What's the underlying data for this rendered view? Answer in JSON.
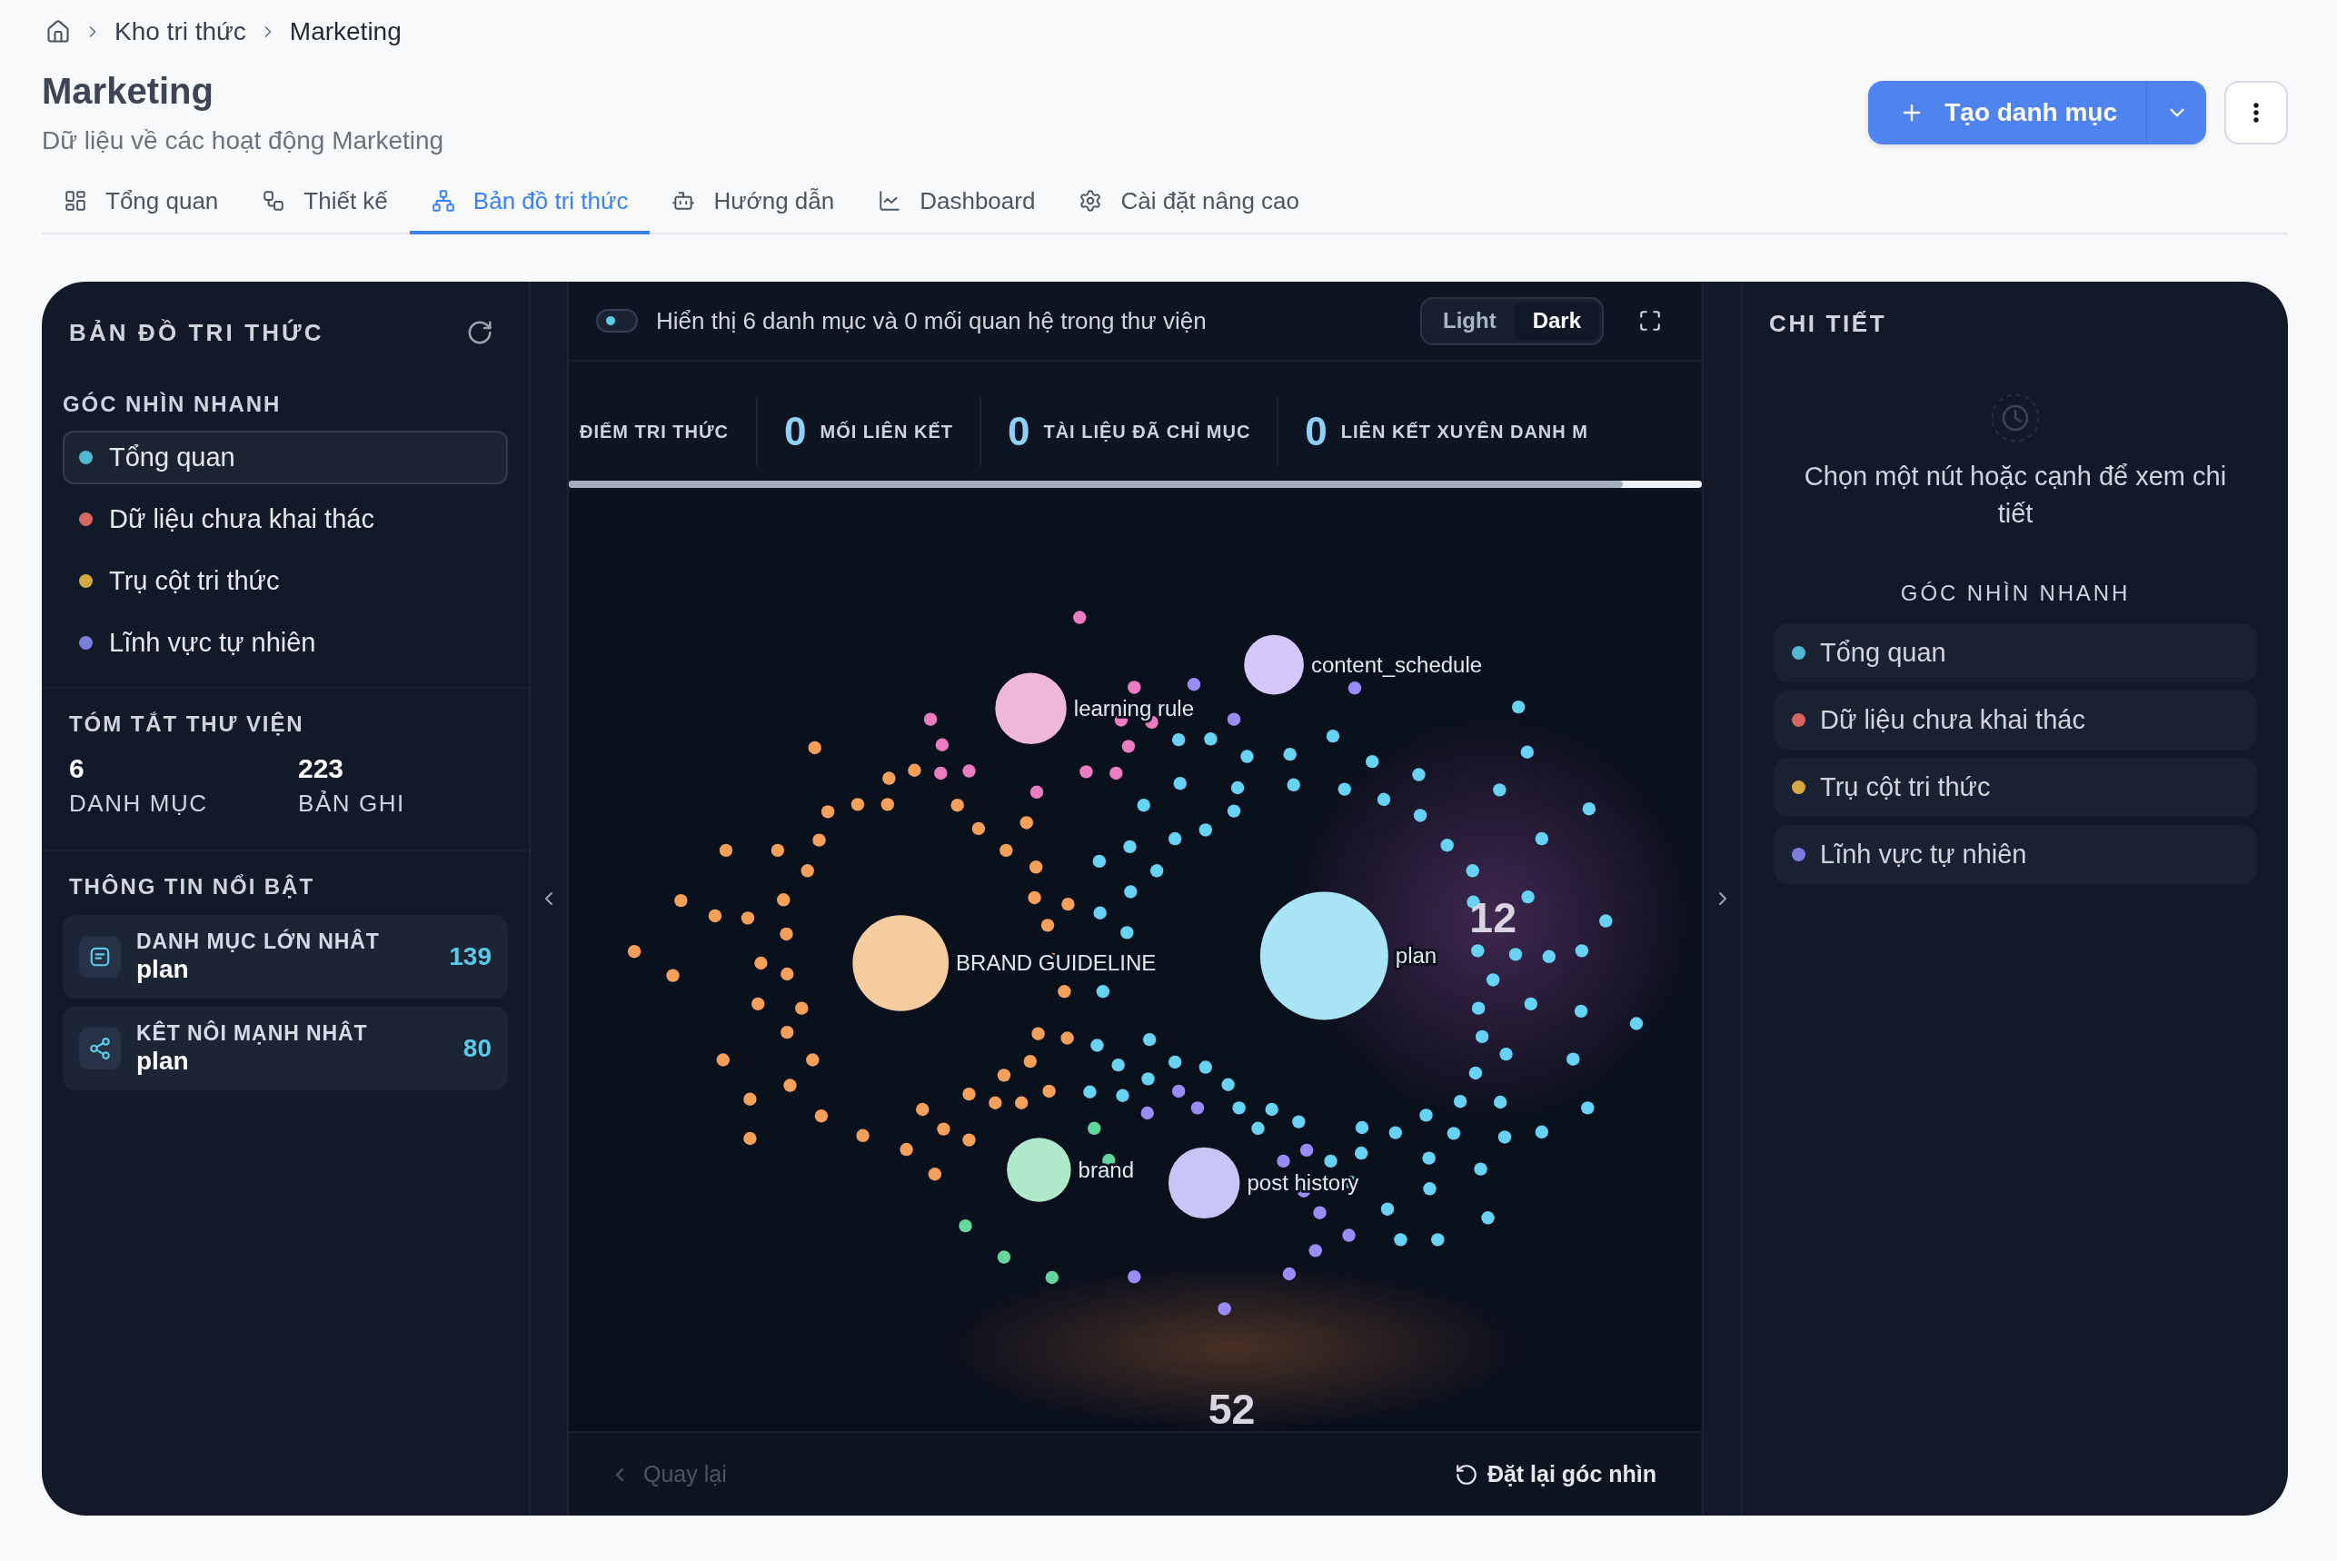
{
  "breadcrumb": [
    "Kho tri thức",
    "Marketing"
  ],
  "page": {
    "title": "Marketing",
    "subtitle": "Dữ liệu về các hoạt động Marketing"
  },
  "actions": {
    "create_button": "Tạo danh mục"
  },
  "tabs": [
    {
      "label": "Tổng quan",
      "selected": false
    },
    {
      "label": "Thiết kế",
      "selected": false
    },
    {
      "label": "Bản đồ tri thức",
      "selected": true
    },
    {
      "label": "Hướng dẫn",
      "selected": false
    },
    {
      "label": "Dashboard",
      "selected": false
    },
    {
      "label": "Cài đặt nâng cao",
      "selected": false
    }
  ],
  "left_panel": {
    "title": "BẢN ĐỒ TRI THỨC",
    "quick_views_title": "GÓC NHÌN NHANH",
    "quick_views": [
      {
        "label": "Tổng quan",
        "color": "#52b9d3",
        "selected": true
      },
      {
        "label": "Dữ liệu chưa khai thác",
        "color": "#d4675f",
        "selected": false
      },
      {
        "label": "Trụ cột tri thức",
        "color": "#d6a943",
        "selected": false
      },
      {
        "label": "Lĩnh vực tự nhiên",
        "color": "#7b7fdc",
        "selected": false
      }
    ],
    "summary_title": "TÓM TẮT THƯ VIỆN",
    "summary": [
      {
        "value": "6",
        "label": "DANH MỤC"
      },
      {
        "value": "223",
        "label": "BẢN GHI"
      }
    ],
    "highlights_title": "THÔNG TIN NỔI BẬT",
    "highlights": [
      {
        "label": "DANH MỤC LỚN NHÂT",
        "name": "plan",
        "value": "139"
      },
      {
        "label": "KÊT NÔI MẠNH NHÂT",
        "name": "plan",
        "value": "80"
      }
    ]
  },
  "toolbar": {
    "toggle_on": true,
    "summary": "Hiển thị 6 danh mục và 0 mối quan hệ trong thư viện",
    "themes": [
      {
        "label": "Light",
        "selected": false
      },
      {
        "label": "Dark",
        "selected": true
      }
    ]
  },
  "stats": [
    {
      "label": "ĐIỂM TRI THỨC"
    },
    {
      "value": "0",
      "label": "MỐI LIÊN KẾT"
    },
    {
      "value": "0",
      "label": "TÀI LIỆU ĐÃ CHỈ MỤC"
    },
    {
      "value": "0",
      "label": "LIÊN KẾT XUYÊN DANH M"
    }
  ],
  "graph": {
    "nodes": [
      {
        "label": "content_schedule",
        "color": "#d4c8fa"
      },
      {
        "label": "learning rule",
        "color": "#f0b8d8"
      },
      {
        "label": "BRAND GUIDELINE",
        "color": "#f5cba0"
      },
      {
        "label": "plan",
        "color": "#a8e4f5"
      },
      {
        "label": "brand",
        "color": "#b0e8cc"
      },
      {
        "label": "post history",
        "color": "#c8c4f5"
      }
    ],
    "cluster_counts": [
      "12",
      "52"
    ]
  },
  "graph_footer": {
    "back": {
      "label": "Quay lại",
      "disabled": true
    },
    "reset": "Đặt lại góc nhìn"
  },
  "detail_panel": {
    "title": "CHI TIẾT",
    "empty_message": "Chọn một nút hoặc cạnh để xem chi tiết",
    "quick_views_title": "GÓC NHÌN NHANH",
    "quick_views": [
      {
        "label": "Tổng quan",
        "color": "#52b9d3"
      },
      {
        "label": "Dữ liệu chưa khai thác",
        "color": "#d4675f"
      },
      {
        "label": "Trụ cột tri thức",
        "color": "#d6a943"
      },
      {
        "label": "Lĩnh vực tự nhiên",
        "color": "#7b7fdc"
      }
    ]
  }
}
